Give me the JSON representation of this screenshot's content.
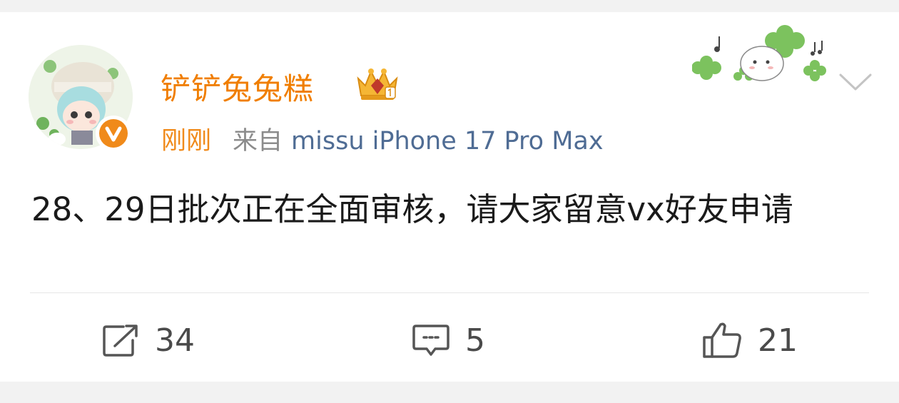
{
  "post": {
    "username": "铲铲兔兔糕",
    "time": "刚刚",
    "source_prefix": "来自",
    "device": "missu iPhone 17 Pro Max",
    "content": "28、29日批次正在全面审核，请大家留意vx好友申请"
  },
  "actions": {
    "repost_count": "34",
    "comment_count": "5",
    "like_count": "21"
  },
  "colors": {
    "username": "#f07e00",
    "time": "#f08a1a",
    "device": "#4f6c94",
    "verified_badge": "#f08a1a"
  },
  "icons": {
    "verified": "verified-v-icon",
    "crown": "crown-badge-icon",
    "menu": "chevron-down-icon",
    "repost": "repost-icon",
    "comment": "comment-icon",
    "like": "thumbs-up-icon"
  }
}
